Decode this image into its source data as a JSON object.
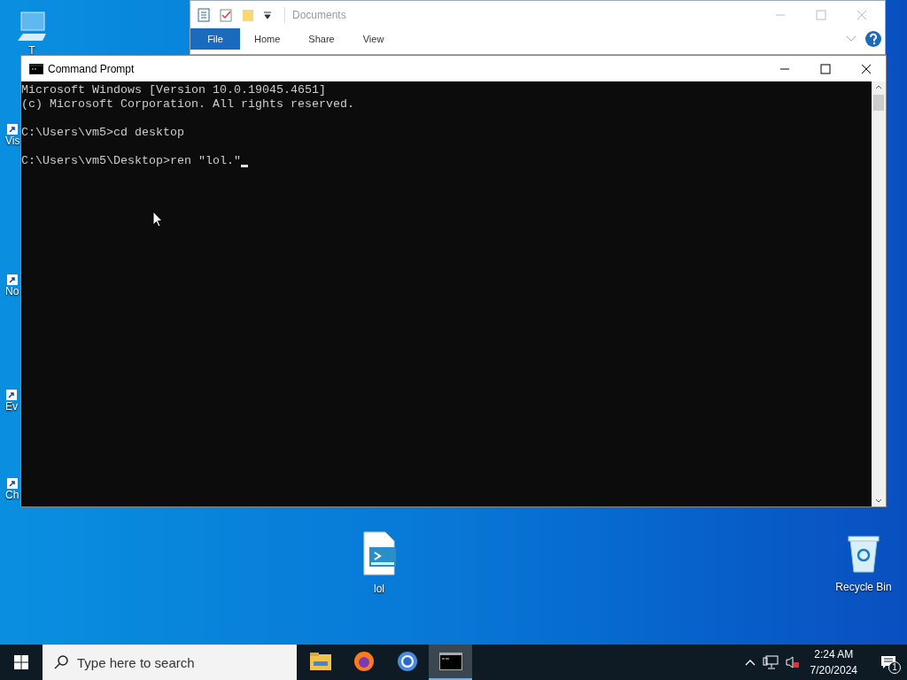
{
  "desktop_icons_left": [
    {
      "label": "T",
      "kind": "pc"
    },
    {
      "label": "Vis",
      "kind": "shortcut"
    },
    {
      "label": "No",
      "kind": "shortcut"
    },
    {
      "label": "Ev",
      "kind": "shortcut"
    },
    {
      "label": "Ch",
      "kind": "shortcut"
    }
  ],
  "desktop_icons": [
    {
      "label": "lol",
      "kind": "script"
    },
    {
      "label": "Recycle Bin",
      "kind": "bin"
    }
  ],
  "explorer": {
    "title": "Documents",
    "tabs": [
      {
        "label": "File",
        "selected": true
      },
      {
        "label": "Home",
        "selected": false
      },
      {
        "label": "Share",
        "selected": false
      },
      {
        "label": "View",
        "selected": false
      }
    ]
  },
  "console": {
    "title": "Command Prompt",
    "lines": [
      {
        "kind": "text",
        "text": "Microsoft Windows [Version 10.0.19045.4651]"
      },
      {
        "kind": "text",
        "text": "(c) Microsoft Corporation. All rights reserved."
      },
      {
        "kind": "blank"
      },
      {
        "kind": "text",
        "text": "C:\\Users\\vm5>cd desktop"
      },
      {
        "kind": "blank"
      },
      {
        "kind": "text",
        "text": "C:\\Users\\vm5\\Desktop>ren \"lol.\""
      }
    ],
    "cursor_visible": true
  },
  "taskbar": {
    "search_placeholder": "Type here to search",
    "apps": [
      {
        "kind": "folder",
        "selected": false
      },
      {
        "kind": "firefox",
        "selected": false
      },
      {
        "kind": "chrome",
        "selected": false
      },
      {
        "kind": "terminal",
        "selected": true
      }
    ],
    "time": "2:24 AM",
    "date": "7/20/2024",
    "notification_count": "1"
  }
}
